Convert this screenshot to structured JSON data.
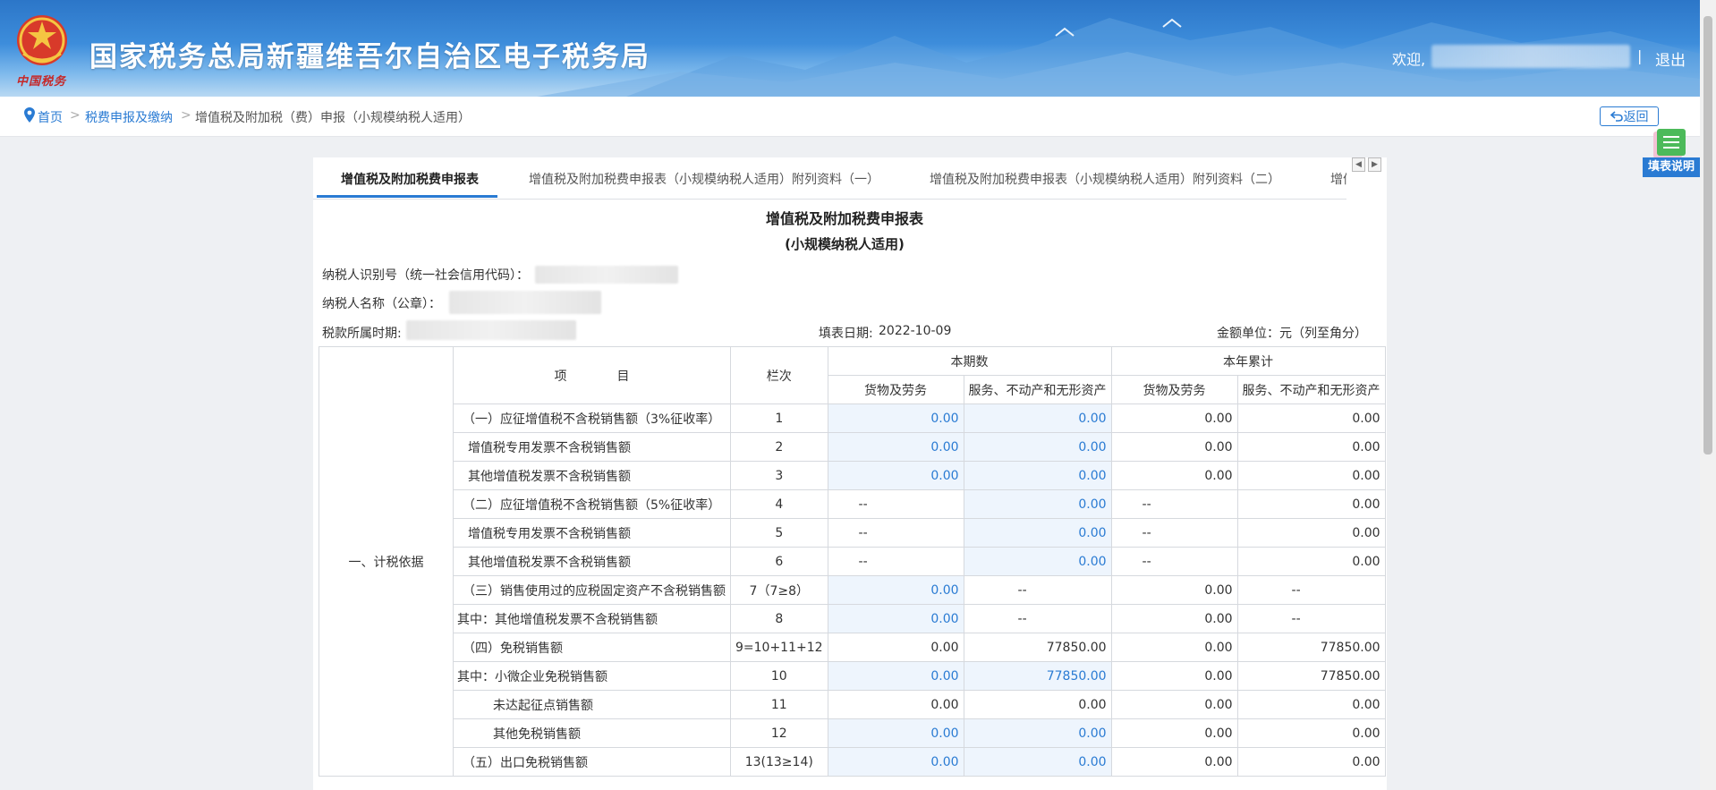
{
  "header": {
    "site_title": "国家税务总局新疆维吾尔自治区电子税务局",
    "emblem_caption": "中国税务",
    "welcome": "欢迎,",
    "separator": "|",
    "logout": "退出"
  },
  "breadcrumb": {
    "home": "首页",
    "sep": ">",
    "section": "税费申报及缴纳",
    "current": "增值税及附加税（费）申报（小规模纳税人适用）"
  },
  "back_label": "返回",
  "help_label": "填表说明",
  "tabs": [
    {
      "label": "增值税及附加税费申报表"
    },
    {
      "label": "增值税及附加税费申报表（小规模纳税人适用）附列资料（一）"
    },
    {
      "label": "增值税及附加税费申报表（小规模纳税人适用）附列资料（二）"
    },
    {
      "label": "增值"
    }
  ],
  "form": {
    "title": "增值税及附加税费申报表",
    "subtitle": "(小规模纳税人适用)",
    "taxpayer_id_label": "纳税人识别号（统一社会信用代码）：",
    "taxpayer_name_label": "纳税人名称（公章）：",
    "period_label": "税款所属时期:",
    "fill_date_label": "填表日期:",
    "fill_date": "2022-10-09",
    "unit_label": "金额单位：元（列至角分）"
  },
  "table": {
    "section_label": "一、计税依据",
    "header": {
      "item": "项　　　　目",
      "column_no": "栏次",
      "current_period": "本期数",
      "year_total": "本年累计",
      "goods": "货物及劳务",
      "services": "服务、不动产和无形资产"
    },
    "rows": [
      {
        "item": "（一）应征增值税不含税销售额（3%征收率）",
        "no": "1",
        "cur_goods": "0.00",
        "cur_serv": "0.00",
        "yr_goods": "0.00",
        "yr_serv": "0.00"
      },
      {
        "item": "增值税专用发票不含税销售额",
        "no": "2",
        "cur_goods": "0.00",
        "cur_serv": "0.00",
        "yr_goods": "0.00",
        "yr_serv": "0.00"
      },
      {
        "item": "其他增值税发票不含税销售额",
        "no": "3",
        "cur_goods": "0.00",
        "cur_serv": "0.00",
        "yr_goods": "0.00",
        "yr_serv": "0.00"
      },
      {
        "item": "（二）应征增值税不含税销售额（5%征收率）",
        "no": "4",
        "cur_goods": "--",
        "cur_serv": "0.00",
        "yr_goods": "--",
        "yr_serv": "0.00"
      },
      {
        "item": "增值税专用发票不含税销售额",
        "no": "5",
        "cur_goods": "--",
        "cur_serv": "0.00",
        "yr_goods": "--",
        "yr_serv": "0.00"
      },
      {
        "item": "其他增值税发票不含税销售额",
        "no": "6",
        "cur_goods": "--",
        "cur_serv": "0.00",
        "yr_goods": "--",
        "yr_serv": "0.00"
      },
      {
        "item": "（三）销售使用过的应税固定资产不含税销售额",
        "no": "7（7≥8）",
        "cur_goods": "0.00",
        "cur_serv": "--",
        "yr_goods": "0.00",
        "yr_serv": "--"
      },
      {
        "item": "其中：其他增值税发票不含税销售额",
        "no": "8",
        "cur_goods": "0.00",
        "cur_serv": "--",
        "yr_goods": "0.00",
        "yr_serv": "--"
      },
      {
        "item": "（四）免税销售额",
        "no": "9=10+11+12",
        "cur_goods": "0.00",
        "cur_serv": "77850.00",
        "yr_goods": "0.00",
        "yr_serv": "77850.00"
      },
      {
        "item": "其中：小微企业免税销售额",
        "no": "10",
        "cur_goods": "0.00",
        "cur_serv": "77850.00",
        "yr_goods": "0.00",
        "yr_serv": "77850.00"
      },
      {
        "item": "未达起征点销售额",
        "no": "11",
        "cur_goods": "0.00",
        "cur_serv": "0.00",
        "yr_goods": "0.00",
        "yr_serv": "0.00"
      },
      {
        "item": "其他免税销售额",
        "no": "12",
        "cur_goods": "0.00",
        "cur_serv": "0.00",
        "yr_goods": "0.00",
        "yr_serv": "0.00"
      },
      {
        "item": "（五）出口免税销售额",
        "no": "13(13≥14)",
        "cur_goods": "0.00",
        "cur_serv": "0.00",
        "yr_goods": "0.00",
        "yr_serv": "0.00"
      }
    ]
  },
  "colors": {
    "brand_blue": "#2a7bd3",
    "editable_bg": "#eef5fd",
    "help_green": "#4cba5a"
  }
}
